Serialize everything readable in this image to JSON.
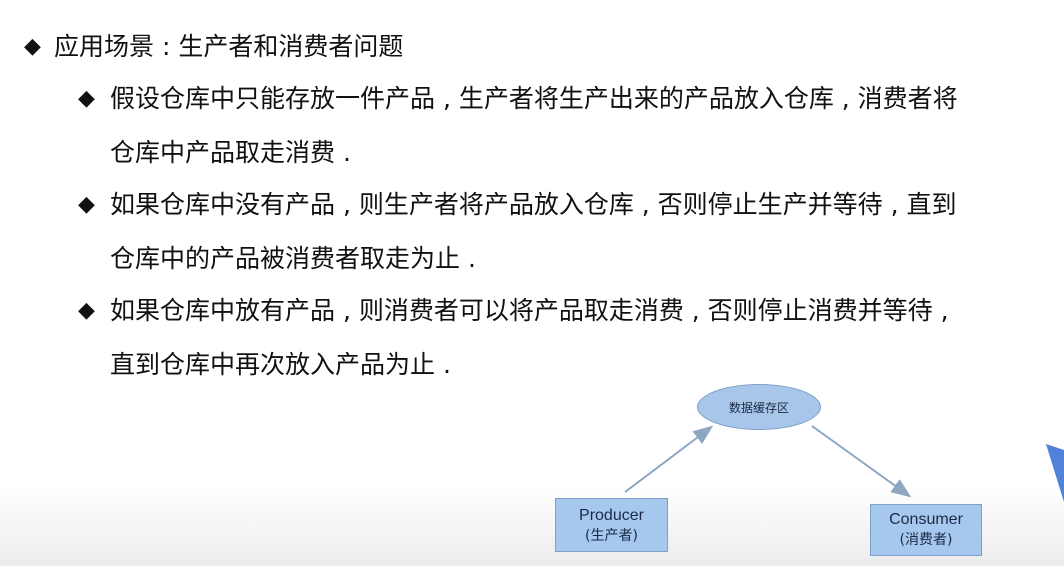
{
  "bullets": {
    "main": "应用场景 : 生产者和消费者问题",
    "sub": [
      {
        "line1": "假设仓库中只能存放一件产品 , 生产者将生产出来的产品放入仓库 , 消费者将",
        "line2": "仓库中产品取走消费 ."
      },
      {
        "line1": "如果仓库中没有产品 , 则生产者将产品放入仓库 , 否则停止生产并等待 , 直到",
        "line2": "仓库中的产品被消费者取走为止 ."
      },
      {
        "line1": "如果仓库中放有产品 , 则消费者可以将产品取走消费 , 否则停止消费并等待 ,",
        "line2": "直到仓库中再次放入产品为止 ."
      }
    ],
    "marker": "◆"
  },
  "diagram": {
    "buffer_label": "数据缓存区",
    "producer": {
      "label": "Producer",
      "sub": "(生产者)"
    },
    "consumer": {
      "label": "Consumer",
      "sub": "(消费者)"
    }
  },
  "colors": {
    "box_fill": "#a6c8ef",
    "arrow": "#8da6c2",
    "corner_accent": "#4f82d8"
  }
}
